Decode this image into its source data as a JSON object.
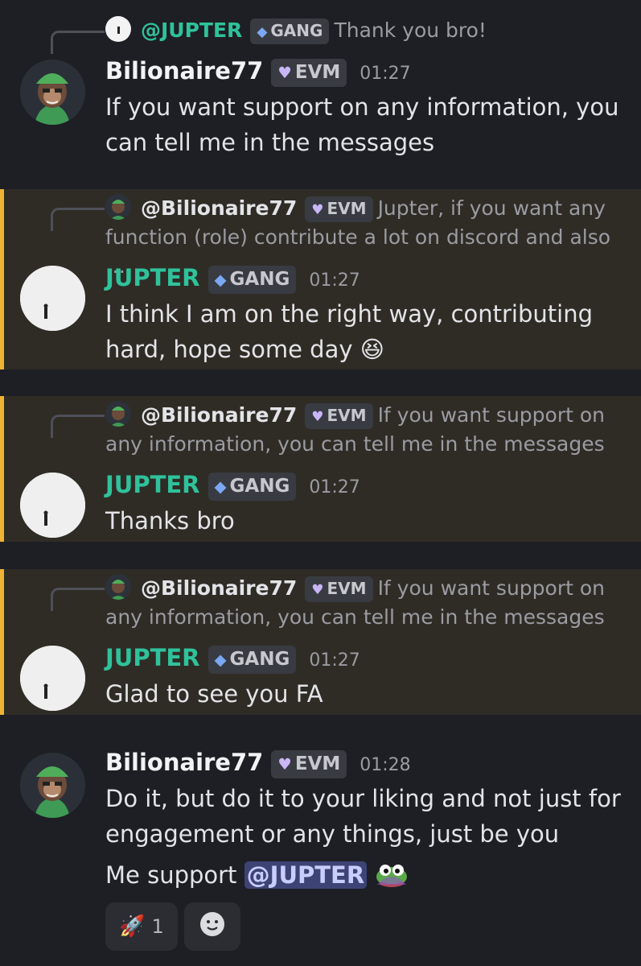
{
  "messages": [
    {
      "reply": {
        "name": "@JUPTER",
        "badge": "GANG",
        "text": "Thank you bro!"
      },
      "author": "Bilionaire77",
      "badge": "EVM",
      "time": "01:27",
      "text": "If you want support on any information, you can tell me in the messages"
    },
    {
      "reply": {
        "name": "@Bilionaire77",
        "badge": "EVM",
        "text": "Jupter, if you want any function (role) contribute a lot on discord and also …"
      },
      "author": "JUPTER",
      "badge": "GANG",
      "time": "01:27",
      "text": "I think I am on the right way, contributing hard, hope some day",
      "emoji": "😆"
    },
    {
      "reply": {
        "name": "@Bilionaire77",
        "badge": "EVM",
        "text": "If you want support on any information, you can tell me in the messages"
      },
      "author": "JUPTER",
      "badge": "GANG",
      "time": "01:27",
      "text": "Thanks bro"
    },
    {
      "reply": {
        "name": "@Bilionaire77",
        "badge": "EVM",
        "text": "If you want support on any information, you can tell me in the messages"
      },
      "author": "JUPTER",
      "badge": "GANG",
      "time": "01:27",
      "text": "Glad to see you FA"
    },
    {
      "author": "Bilionaire77",
      "badge": "EVM",
      "time": "01:28",
      "text": "Do it, but do it to your liking and not just for engagement or any things, just be you",
      "text2_prefix": "Me support",
      "mention": "@JUPTER",
      "emoji": "pepe-emoji"
    }
  ],
  "reactions": [
    {
      "icon": "rocket-icon",
      "glyph": "🚀",
      "count": "1"
    },
    {
      "icon": "add-reaction-icon"
    }
  ],
  "colors": {
    "highlight_bar": "#f0b232",
    "highlight_bg": "#2f2c26",
    "green_name": "#2fc29b",
    "bg": "#1e1f24"
  }
}
